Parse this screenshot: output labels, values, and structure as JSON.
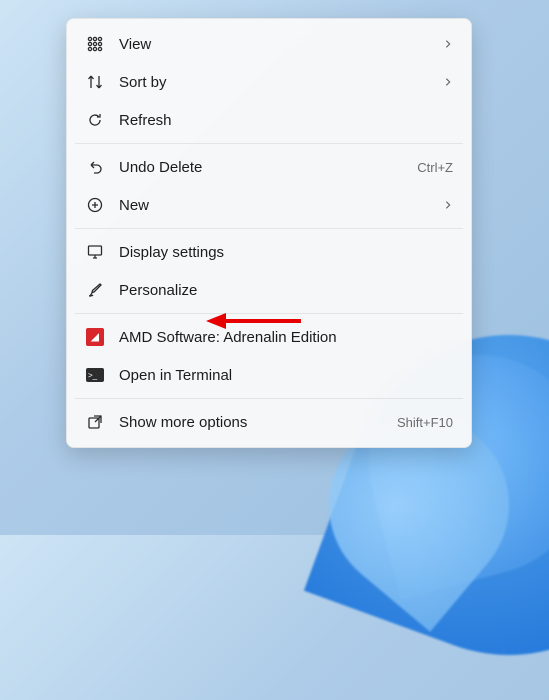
{
  "menu": {
    "view": {
      "label": "View",
      "submenu": true
    },
    "sort": {
      "label": "Sort by",
      "submenu": true
    },
    "refresh": {
      "label": "Refresh"
    },
    "undo": {
      "label": "Undo Delete",
      "shortcut": "Ctrl+Z"
    },
    "new": {
      "label": "New",
      "submenu": true
    },
    "display": {
      "label": "Display settings"
    },
    "personalize": {
      "label": "Personalize"
    },
    "amd": {
      "label": "AMD Software: Adrenalin Edition"
    },
    "terminal": {
      "label": "Open in Terminal"
    },
    "more": {
      "label": "Show more options",
      "shortcut": "Shift+F10"
    }
  },
  "annotation": {
    "points_to": "personalize"
  }
}
